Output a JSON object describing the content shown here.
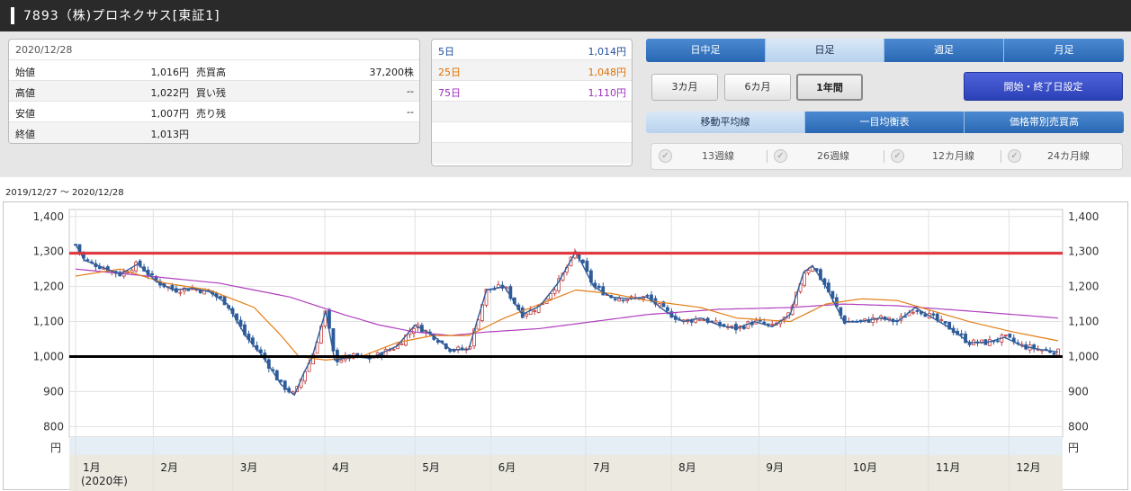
{
  "header": {
    "title": "7893（株)プロネクサス[東証1]"
  },
  "quote": {
    "date": "2020/12/28",
    "rows": [
      {
        "label": "始値",
        "value": "1,016円",
        "label2": "売買高",
        "value2": "37,200株"
      },
      {
        "label": "高値",
        "value": "1,022円",
        "label2": "買い残",
        "value2": "--"
      },
      {
        "label": "安値",
        "value": "1,007円",
        "label2": "売り残",
        "value2": "--"
      },
      {
        "label": "終値",
        "value": "1,013円",
        "label2": "",
        "value2": ""
      }
    ]
  },
  "moving_averages": [
    {
      "label": "5日",
      "value": "1,014円",
      "color": "#1f4e9c"
    },
    {
      "label": "25日",
      "value": "1,048円",
      "color": "#e07000"
    },
    {
      "label": "75日",
      "value": "1,110円",
      "color": "#a02fbf"
    }
  ],
  "period_tabs": [
    {
      "label": "日中足",
      "active": false
    },
    {
      "label": "日足",
      "active": true
    },
    {
      "label": "週足",
      "active": false
    },
    {
      "label": "月足",
      "active": false
    }
  ],
  "range_buttons": [
    {
      "label": "3カ月",
      "active": false
    },
    {
      "label": "6カ月",
      "active": false
    },
    {
      "label": "1年間",
      "active": true
    }
  ],
  "date_setting_button": "開始・終了日設定",
  "indicator_tabs": [
    {
      "label": "移動平均線",
      "active": true
    },
    {
      "label": "一目均衡表",
      "active": false
    },
    {
      "label": "価格帯別売買高",
      "active": false
    }
  ],
  "week_checks": [
    "13週線",
    "26週線",
    "12カ月線",
    "24カ月線"
  ],
  "chart": {
    "period_label": "2019/12/27 〜 2020/12/28",
    "y_unit": "円",
    "colors": {
      "up": "#c23c3c",
      "down": "#2e5c9a",
      "ma5": "#2e5c9a",
      "ma25": "#e47d16",
      "ma75": "#b13fbf",
      "red_line": "#e1323a",
      "black_line": "#000000"
    }
  },
  "chart_data": {
    "type": "candlestick",
    "title": "",
    "xlabel": "",
    "ylabel": "円",
    "ylim": [
      770,
      1420
    ],
    "yticks": [
      "800",
      "900",
      "1,000",
      "1,100",
      "1,200",
      "1,300",
      "1,400"
    ],
    "months": [
      {
        "label": "1月",
        "sub": "(2020年)",
        "pos": 0.0
      },
      {
        "label": "2月",
        "sub": "",
        "pos": 0.087
      },
      {
        "label": "3月",
        "sub": "",
        "pos": 0.176
      },
      {
        "label": "4月",
        "sub": "",
        "pos": 0.279
      },
      {
        "label": "5月",
        "sub": "",
        "pos": 0.38
      },
      {
        "label": "6月",
        "sub": "",
        "pos": 0.465
      },
      {
        "label": "7月",
        "sub": "",
        "pos": 0.571
      },
      {
        "label": "8月",
        "sub": "",
        "pos": 0.667
      },
      {
        "label": "9月",
        "sub": "",
        "pos": 0.765
      },
      {
        "label": "10月",
        "sub": "",
        "pos": 0.862
      },
      {
        "label": "11月",
        "sub": "",
        "pos": 0.955
      },
      {
        "label": "12月",
        "sub": "",
        "pos": 1.045
      }
    ],
    "close_path": [
      [
        0,
        1320
      ],
      [
        0.01,
        1275
      ],
      [
        0.03,
        1255
      ],
      [
        0.05,
        1235
      ],
      [
        0.07,
        1265
      ],
      [
        0.09,
        1215
      ],
      [
        0.11,
        1190
      ],
      [
        0.13,
        1195
      ],
      [
        0.15,
        1185
      ],
      [
        0.17,
        1150
      ],
      [
        0.19,
        1060
      ],
      [
        0.21,
        1000
      ],
      [
        0.23,
        920
      ],
      [
        0.245,
        890
      ],
      [
        0.255,
        950
      ],
      [
        0.265,
        1000
      ],
      [
        0.28,
        1130
      ],
      [
        0.29,
        990
      ],
      [
        0.31,
        1000
      ],
      [
        0.33,
        995
      ],
      [
        0.36,
        1030
      ],
      [
        0.38,
        1090
      ],
      [
        0.4,
        1060
      ],
      [
        0.42,
        1020
      ],
      [
        0.44,
        1020
      ],
      [
        0.46,
        1190
      ],
      [
        0.48,
        1200
      ],
      [
        0.5,
        1120
      ],
      [
        0.52,
        1145
      ],
      [
        0.54,
        1210
      ],
      [
        0.56,
        1300
      ],
      [
        0.58,
        1200
      ],
      [
        0.6,
        1170
      ],
      [
        0.62,
        1165
      ],
      [
        0.64,
        1170
      ],
      [
        0.66,
        1130
      ],
      [
        0.68,
        1100
      ],
      [
        0.7,
        1110
      ],
      [
        0.72,
        1090
      ],
      [
        0.74,
        1080
      ],
      [
        0.76,
        1100
      ],
      [
        0.78,
        1085
      ],
      [
        0.8,
        1120
      ],
      [
        0.815,
        1240
      ],
      [
        0.825,
        1260
      ],
      [
        0.84,
        1200
      ],
      [
        0.86,
        1100
      ],
      [
        0.88,
        1100
      ],
      [
        0.9,
        1110
      ],
      [
        0.92,
        1100
      ],
      [
        0.94,
        1140
      ],
      [
        0.96,
        1110
      ],
      [
        0.98,
        1080
      ],
      [
        1.0,
        1040
      ],
      [
        1.02,
        1040
      ],
      [
        1.04,
        1055
      ],
      [
        1.06,
        1030
      ],
      [
        1.08,
        1020
      ],
      [
        1.1,
        1013
      ]
    ],
    "ma25_path": [
      [
        0,
        1230
      ],
      [
        0.05,
        1250
      ],
      [
        0.1,
        1210
      ],
      [
        0.15,
        1190
      ],
      [
        0.2,
        1140
      ],
      [
        0.23,
        1060
      ],
      [
        0.25,
        1000
      ],
      [
        0.28,
        990
      ],
      [
        0.32,
        1000
      ],
      [
        0.36,
        1040
      ],
      [
        0.4,
        1060
      ],
      [
        0.44,
        1060
      ],
      [
        0.48,
        1110
      ],
      [
        0.52,
        1150
      ],
      [
        0.56,
        1190
      ],
      [
        0.6,
        1180
      ],
      [
        0.64,
        1160
      ],
      [
        0.7,
        1140
      ],
      [
        0.74,
        1110
      ],
      [
        0.8,
        1100
      ],
      [
        0.84,
        1150
      ],
      [
        0.88,
        1165
      ],
      [
        0.92,
        1160
      ],
      [
        0.96,
        1130
      ],
      [
        1.0,
        1100
      ],
      [
        1.05,
        1070
      ],
      [
        1.1,
        1045
      ]
    ],
    "ma75_path": [
      [
        0,
        1250
      ],
      [
        0.08,
        1230
      ],
      [
        0.16,
        1210
      ],
      [
        0.24,
        1170
      ],
      [
        0.3,
        1120
      ],
      [
        0.34,
        1090
      ],
      [
        0.38,
        1070
      ],
      [
        0.42,
        1060
      ],
      [
        0.46,
        1070
      ],
      [
        0.52,
        1080
      ],
      [
        0.58,
        1100
      ],
      [
        0.64,
        1120
      ],
      [
        0.72,
        1135
      ],
      [
        0.8,
        1140
      ],
      [
        0.86,
        1150
      ],
      [
        0.92,
        1145
      ],
      [
        1.0,
        1130
      ],
      [
        1.1,
        1110
      ]
    ],
    "red_line": 1295,
    "black_line": 1000
  }
}
